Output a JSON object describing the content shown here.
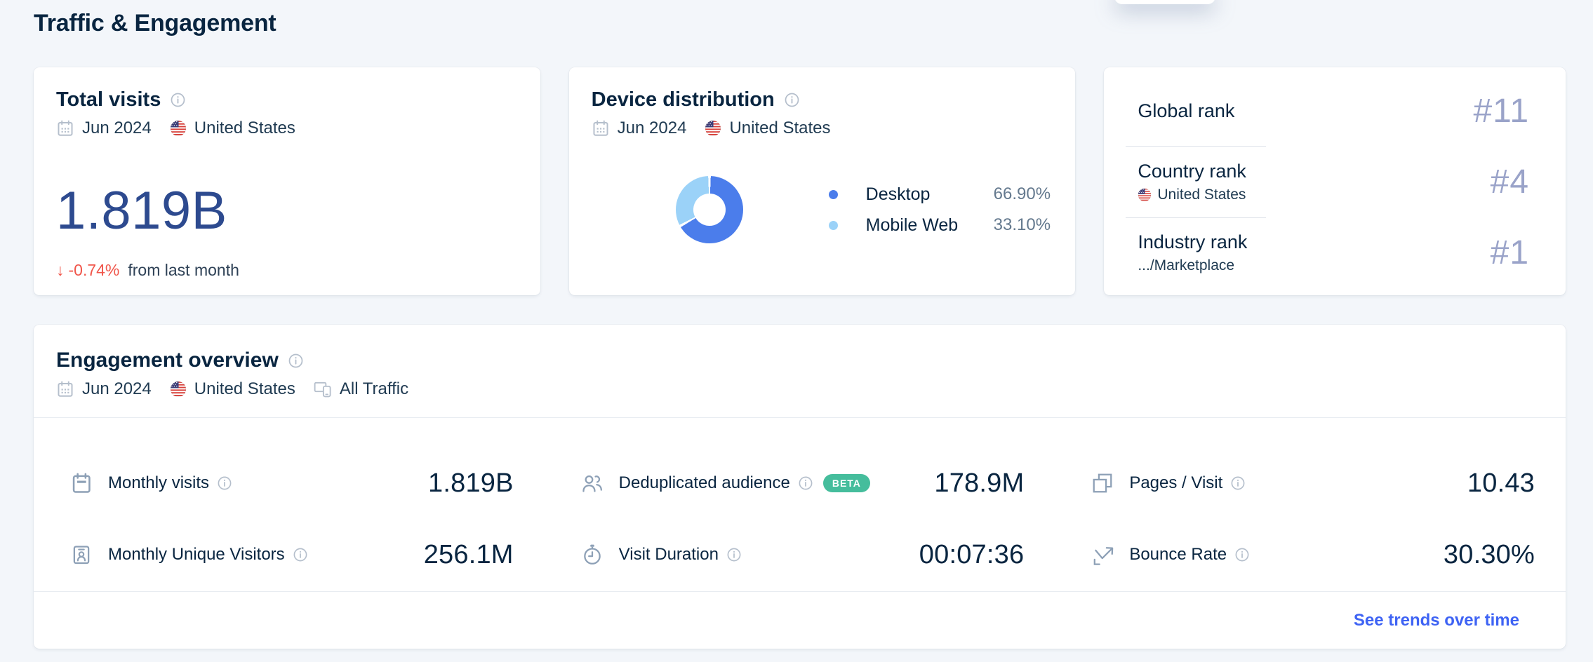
{
  "page": {
    "title": "Traffic & Engagement"
  },
  "colors": {
    "accent_link": "#3e63f4",
    "negative": "#f0554a",
    "big_number": "#2d4a8f",
    "rank_value": "#9aa3c9",
    "beta_badge": "#45bd9c",
    "text_dark": "#092540"
  },
  "total_visits": {
    "title": "Total visits",
    "period": "Jun 2024",
    "country": "United States",
    "value": "1.819B",
    "change_arrow": "↓",
    "change": "-0.74%",
    "change_note": "from last month"
  },
  "device_distribution": {
    "title": "Device distribution",
    "period": "Jun 2024",
    "country": "United States",
    "chart_data": {
      "type": "pie",
      "donut": true,
      "labels": [
        "Desktop",
        "Mobile Web"
      ],
      "values": [
        66.9,
        33.1
      ],
      "display_values": [
        "66.90%",
        "33.10%"
      ],
      "colors": [
        "#4b7deb",
        "#9bd2f8"
      ],
      "legend_position": "right"
    }
  },
  "ranks": {
    "rows": [
      {
        "label": "Global rank",
        "value": "#11"
      },
      {
        "label": "Country rank",
        "sub": "United States",
        "value": "#4"
      },
      {
        "label": "Industry rank",
        "sub": ".../Marketplace",
        "value": "#1"
      }
    ]
  },
  "engagement": {
    "title": "Engagement overview",
    "period": "Jun 2024",
    "country": "United States",
    "traffic": "All Traffic",
    "metrics": [
      {
        "label": "Monthly visits",
        "value": "1.819B"
      },
      {
        "label": "Deduplicated audience",
        "badge": "BETA",
        "value": "178.9M"
      },
      {
        "label": "Pages / Visit",
        "value": "10.43"
      },
      {
        "label": "Monthly Unique Visitors",
        "value": "256.1M"
      },
      {
        "label": "Visit Duration",
        "value": "00:07:36"
      },
      {
        "label": "Bounce Rate",
        "value": "30.30%"
      }
    ],
    "footer_link": "See trends over time"
  }
}
